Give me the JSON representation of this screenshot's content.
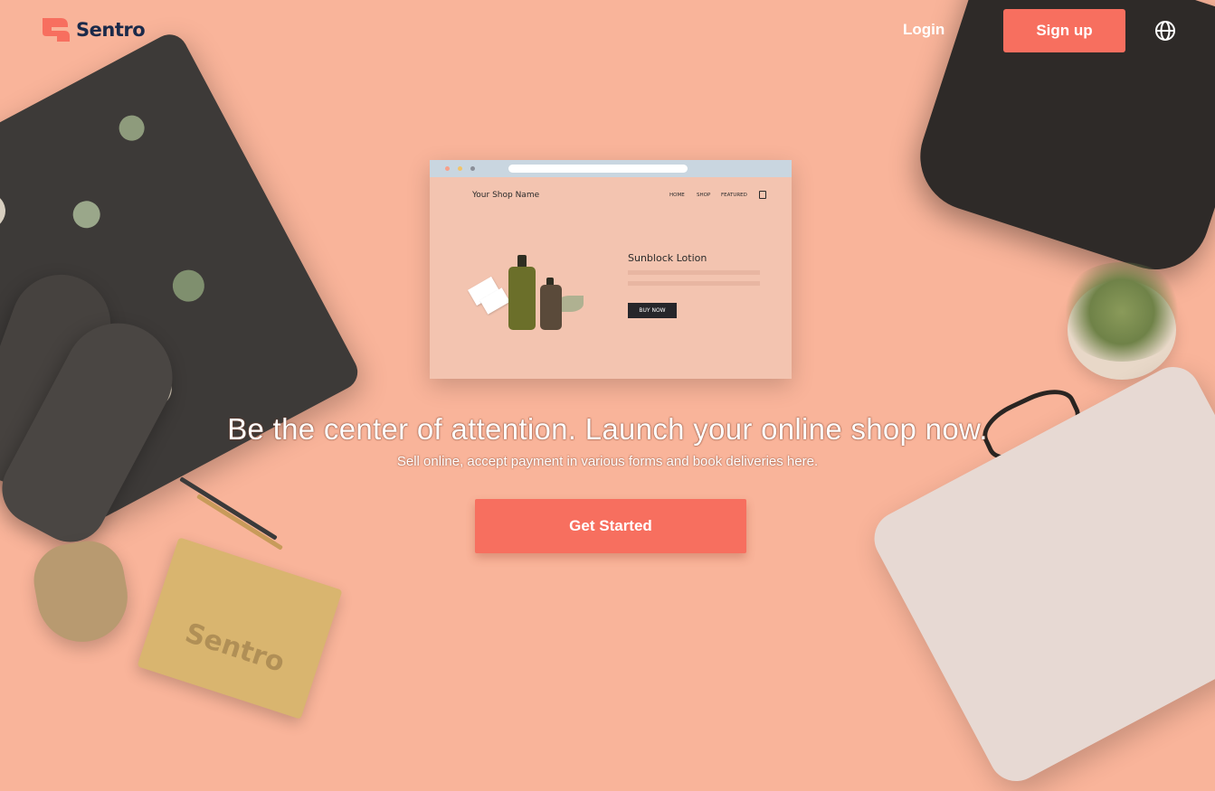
{
  "header": {
    "brand": "Sentro",
    "login_label": "Login",
    "signup_label": "Sign up",
    "language_icon": "globe-icon"
  },
  "mockup": {
    "shop_name": "Your Shop Name",
    "nav": [
      "HOME",
      "SHOP",
      "FEATURED"
    ],
    "cart_icon": "shopping-bag-icon",
    "product_name": "Sunblock Lotion",
    "buy_label": "BUY NOW"
  },
  "hero": {
    "headline": "Be the center of attention. Launch your online shop now.",
    "subline": "Sell online, accept payment in various forms and book deliveries here.",
    "cta_label": "Get Started"
  },
  "decor": {
    "notebook_text": "Sentro"
  },
  "colors": {
    "background": "#f9b49a",
    "accent": "#f76f5f",
    "brand_text": "#1b2a4a"
  }
}
